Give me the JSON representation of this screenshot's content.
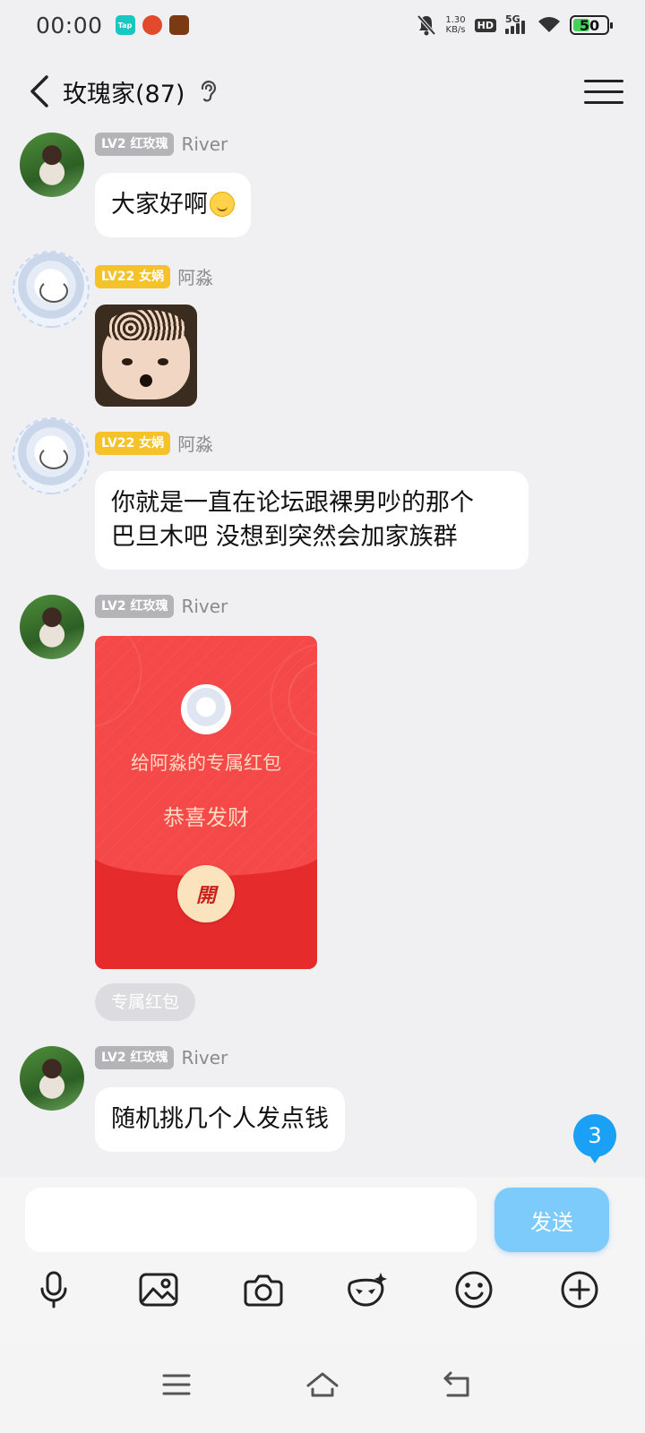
{
  "status_bar": {
    "time": "00:00",
    "app_icons": [
      "taptap-icon",
      "app-icon",
      "game-icon"
    ],
    "net_speed_value": "1.30",
    "net_speed_unit": "KB/s",
    "hd_label": "HD",
    "network_label": "5G",
    "battery_level": "50"
  },
  "header": {
    "title": "玫瑰家(87)"
  },
  "messages": [
    {
      "badge": "LV2 红玫瑰",
      "badge_color": "#b4b4b8",
      "sender": "River",
      "type": "text",
      "text": "大家好啊",
      "emoji": "smiling-face-emoji"
    },
    {
      "badge": "LV22 女娲",
      "badge_color": "#f5c22a",
      "sender": "阿淼",
      "type": "sticker"
    },
    {
      "badge": "LV22 女娲",
      "badge_color": "#f5c22a",
      "sender": "阿淼",
      "type": "text",
      "lines": [
        "你就是一直在论坛跟裸男吵的那个",
        "巴旦木吧 没想到突然会加家族群"
      ]
    },
    {
      "badge": "LV2 红玫瑰",
      "badge_color": "#b4b4b8",
      "sender": "River",
      "type": "red_packet",
      "red_packet": {
        "to": "给阿淼的专属红包",
        "wish": "恭喜发财",
        "open_label": "開",
        "tag": "专属红包"
      }
    },
    {
      "badge": "LV2 红玫瑰",
      "badge_color": "#b4b4b8",
      "sender": "River",
      "type": "text",
      "text": "随机挑几个人发点钱"
    }
  ],
  "unread_count": "3",
  "composer": {
    "input_value": "",
    "send_label": "发送"
  },
  "colors": {
    "accent": "#1aa0f5",
    "send_button": "#7ccbfa",
    "red_packet": "#f54848"
  }
}
